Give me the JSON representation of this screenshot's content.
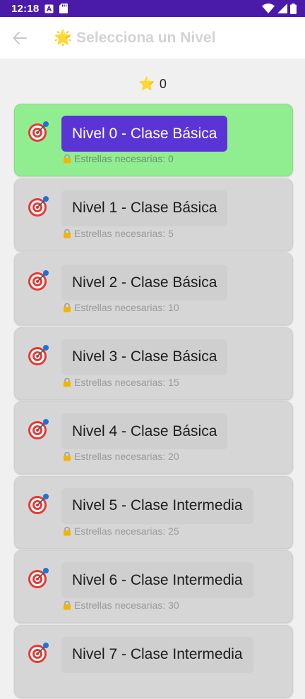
{
  "status_bar": {
    "time": "12:18"
  },
  "app_bar": {
    "title_emoji": "🌟",
    "title": "Selecciona un Nivel"
  },
  "stars": {
    "icon": "⭐",
    "count": "0"
  },
  "levels": [
    {
      "label": "Nivel 0 - Clase Básica",
      "requirement": "Estrellas necesarias: 0",
      "unlocked": true
    },
    {
      "label": "Nivel 1 - Clase Básica",
      "requirement": "Estrellas necesarias: 5",
      "unlocked": false
    },
    {
      "label": "Nivel 2 - Clase Básica",
      "requirement": "Estrellas necesarias: 10",
      "unlocked": false
    },
    {
      "label": "Nivel 3 - Clase Básica",
      "requirement": "Estrellas necesarias: 15",
      "unlocked": false
    },
    {
      "label": "Nivel 4 - Clase Básica",
      "requirement": "Estrellas necesarias: 20",
      "unlocked": false
    },
    {
      "label": "Nivel 5 - Clase Intermedia",
      "requirement": "Estrellas necesarias: 25",
      "unlocked": false
    },
    {
      "label": "Nivel 6 - Clase Intermedia",
      "requirement": "Estrellas necesarias: 30",
      "unlocked": false
    },
    {
      "label": "Nivel 7 - Clase Intermedia",
      "requirement": "",
      "unlocked": false
    }
  ],
  "colors": {
    "status_bar": "#4a1aa8",
    "unlocked_card": "#90ee90",
    "locked_card": "#d6d6d6",
    "primary_button": "#5b34d6",
    "locked_button": "#cfcfcf"
  }
}
